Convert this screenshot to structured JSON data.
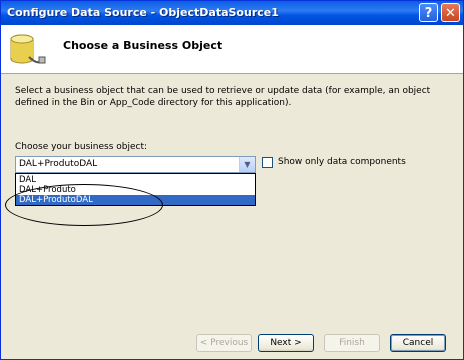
{
  "window": {
    "title": "Configure Data Source - ObjectDataSource1",
    "help_button": "?",
    "close_button": "✕"
  },
  "header": {
    "title": "Choose a Business Object",
    "icon": "database-connector-icon"
  },
  "description": "Select a business object that can be used to retrieve or update data (for example, an object defined in the Bin or App_Code directory for this application).",
  "business_object": {
    "label": "Choose your business object:",
    "selected_value": "DAL+ProdutoDAL",
    "options": [
      "DAL",
      "DAL+Produto",
      "DAL+ProdutoDAL"
    ],
    "highlighted_index": 2
  },
  "only_data_components": {
    "label": "Show only data components",
    "checked": false
  },
  "buttons": {
    "previous": "< Previous",
    "next": "Next >",
    "finish": "Finish",
    "cancel": "Cancel"
  },
  "colors": {
    "title_bar": "#0055e5",
    "selection": "#316ac5",
    "dialog_bg": "#ece9d8"
  }
}
